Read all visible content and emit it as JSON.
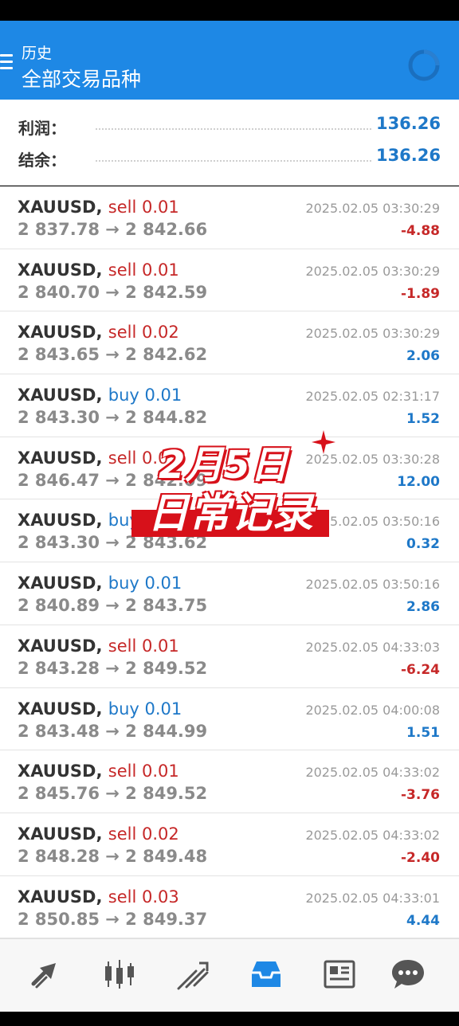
{
  "header": {
    "subtitle": "历史",
    "title": "全部交易品种"
  },
  "summary": {
    "profit_label": "利润：",
    "profit_value": "136.26",
    "balance_label": "结余：",
    "balance_value": "136.26"
  },
  "trades": [
    {
      "symbol": "XAUUSD,",
      "direction": "sell",
      "volume": "sell 0.01",
      "prices": "2 837.78 → 2 842.66",
      "time": "2025.02.05 03:30:29",
      "profit": "-4.88"
    },
    {
      "symbol": "XAUUSD,",
      "direction": "sell",
      "volume": "sell 0.01",
      "prices": "2 840.70 → 2 842.59",
      "time": "2025.02.05 03:30:29",
      "profit": "-1.89"
    },
    {
      "symbol": "XAUUSD,",
      "direction": "sell",
      "volume": "sell 0.02",
      "prices": "2 843.65 → 2 842.62",
      "time": "2025.02.05 03:30:29",
      "profit": "2.06"
    },
    {
      "symbol": "XAUUSD,",
      "direction": "buy",
      "volume": "buy 0.01",
      "prices": "2 843.30 → 2 844.82",
      "time": "2025.02.05 02:31:17",
      "profit": "1.52"
    },
    {
      "symbol": "XAUUSD,",
      "direction": "sell",
      "volume": "sell 0.03",
      "prices": "2 846.47 → 2 842.09",
      "time": "2025.02.05 03:30:28",
      "profit": "12.00"
    },
    {
      "symbol": "XAUUSD,",
      "direction": "buy",
      "volume": "buy 0.01",
      "prices": "2 843.30 → 2 843.62",
      "time": "2025.02.05 03:50:16",
      "profit": "0.32"
    },
    {
      "symbol": "XAUUSD,",
      "direction": "buy",
      "volume": "buy 0.01",
      "prices": "2 840.89 → 2 843.75",
      "time": "2025.02.05 03:50:16",
      "profit": "2.86"
    },
    {
      "symbol": "XAUUSD,",
      "direction": "sell",
      "volume": "sell 0.01",
      "prices": "2 843.28 → 2 849.52",
      "time": "2025.02.05 04:33:03",
      "profit": "-6.24"
    },
    {
      "symbol": "XAUUSD,",
      "direction": "buy",
      "volume": "buy 0.01",
      "prices": "2 843.48 → 2 844.99",
      "time": "2025.02.05 04:00:08",
      "profit": "1.51"
    },
    {
      "symbol": "XAUUSD,",
      "direction": "sell",
      "volume": "sell 0.01",
      "prices": "2 845.76 → 2 849.52",
      "time": "2025.02.05 04:33:02",
      "profit": "-3.76"
    },
    {
      "symbol": "XAUUSD,",
      "direction": "sell",
      "volume": "sell 0.02",
      "prices": "2 848.28 → 2 849.48",
      "time": "2025.02.05 04:33:02",
      "profit": "-2.40"
    },
    {
      "symbol": "XAUUSD,",
      "direction": "sell",
      "volume": "sell 0.03",
      "prices": "2 850.85 → 2 849.37",
      "time": "2025.02.05 04:33:01",
      "profit": "4.44"
    }
  ],
  "overlay": {
    "line1": "2月5日",
    "line2": "日常记录"
  },
  "nav": {
    "items": [
      "quotes-icon",
      "chart-candles-icon",
      "trade-icon",
      "history-icon",
      "news-icon",
      "chat-icon"
    ],
    "active_color": "#1e88e5",
    "inactive_color": "#555555"
  },
  "colors": {
    "header_bg": "#1e88e5",
    "sell": "#c62828",
    "buy": "#1e78c8",
    "overlay_red": "#d7111a"
  }
}
